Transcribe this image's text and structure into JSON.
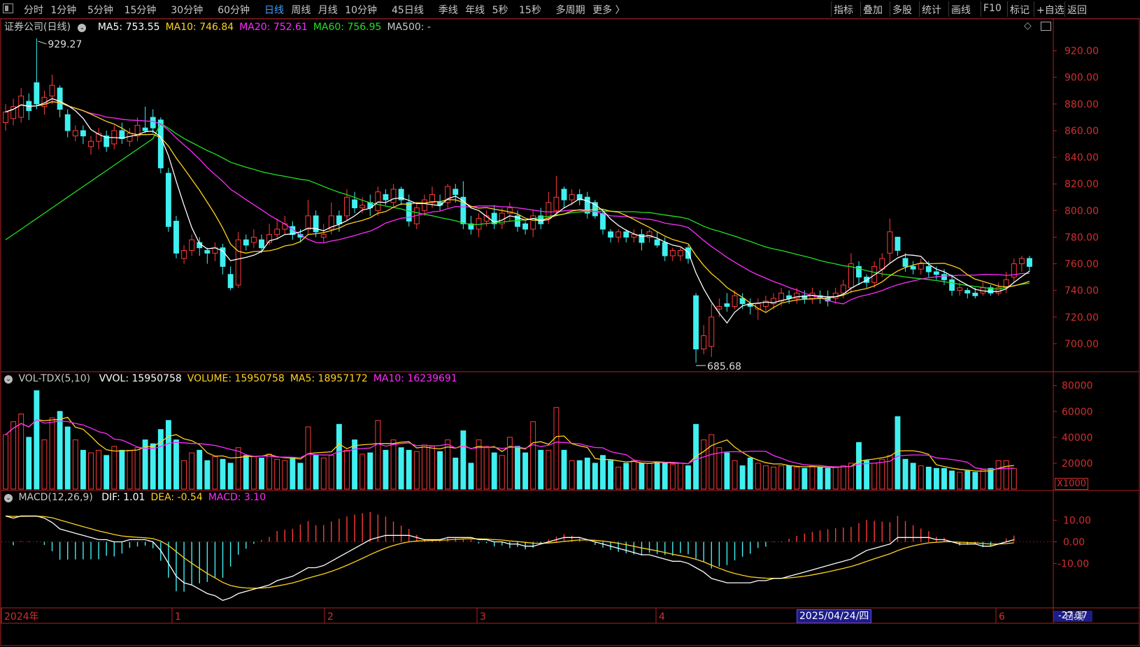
{
  "toolbar": {
    "periods": [
      "分时",
      "1分钟",
      "5分钟",
      "15分钟",
      "30分钟",
      "60分钟",
      "日线",
      "周线",
      "月线",
      "10分钟",
      "45日线",
      "季线",
      "年线",
      "5秒",
      "15秒",
      "多周期",
      "更多 〉"
    ],
    "active_period": "日线",
    "right_buttons": [
      "指标",
      "叠加",
      "多股",
      "统计",
      "画线",
      "F10",
      "标记",
      "+自选",
      "返回"
    ]
  },
  "price_panel": {
    "title": "证券公司(日线)",
    "ma_labels": [
      {
        "text": "MA5: 753.55",
        "color": "#ffffff"
      },
      {
        "text": "MA10: 746.84",
        "color": "#ffd21e"
      },
      {
        "text": "MA20: 752.61",
        "color": "#ff2cff"
      },
      {
        "text": "MA60: 756.95",
        "color": "#22e022"
      },
      {
        "text": "MA500: -",
        "color": "#c8c8c8"
      }
    ],
    "y_ticks": [
      "920.00",
      "900.00",
      "880.00",
      "860.00",
      "840.00",
      "820.00",
      "800.00",
      "780.00",
      "760.00",
      "740.00",
      "720.00",
      "700.00"
    ],
    "high_label": "929.27",
    "low_label": "685.68"
  },
  "volume_panel": {
    "title": "VOL-TDX(5,10)",
    "labels": [
      {
        "text": "VVOL: 15950758",
        "color": "#ffffff"
      },
      {
        "text": "VOLUME: 15950758",
        "color": "#ffd21e"
      },
      {
        "text": "MA5: 18957172",
        "color": "#ffd21e"
      },
      {
        "text": "MA10: 16239691",
        "color": "#ff2cff"
      }
    ],
    "y_ticks": [
      "80000",
      "60000",
      "40000",
      "20000"
    ],
    "unit": "X1000"
  },
  "macd_panel": {
    "title": "MACD(12,26,9)",
    "labels": [
      {
        "text": "DIF: 1.01",
        "color": "#ffffff"
      },
      {
        "text": "DEA: -0.54",
        "color": "#ffd21e"
      },
      {
        "text": "MACD: 3.10",
        "color": "#ff2cff"
      }
    ],
    "y_ticks": [
      "10.00",
      "0.00",
      "-10.00"
    ],
    "min_label": "-27.17"
  },
  "x_axis": {
    "labels": [
      "2024年",
      "1",
      "2",
      "3",
      "4",
      "6"
    ],
    "cursor_date": "2025/04/24/四",
    "period_label": "日线"
  },
  "colors": {
    "up": "#ff3b3b",
    "down": "#40f0f0",
    "ma5": "#ffffff",
    "ma10": "#ffd21e",
    "ma20": "#ff2cff",
    "ma60": "#22e022",
    "axis": "#b02020"
  },
  "chart_data": {
    "type": "candlestick",
    "title": "证券公司(日线)",
    "ylim": [
      680,
      935
    ],
    "candles": [
      [
        866,
        874,
        880,
        860
      ],
      [
        869,
        878,
        884,
        864
      ],
      [
        870,
        886,
        892,
        866
      ],
      [
        882,
        875,
        888,
        868
      ],
      [
        896,
        880,
        929.27,
        876
      ],
      [
        878,
        885,
        890,
        872
      ],
      [
        886,
        894,
        902,
        880
      ],
      [
        892,
        876,
        894,
        870
      ],
      [
        872,
        860,
        876,
        855
      ],
      [
        856,
        860,
        864,
        852
      ],
      [
        860,
        856,
        864,
        850
      ],
      [
        848,
        852,
        856,
        842
      ],
      [
        852,
        858,
        862,
        846
      ],
      [
        856,
        848,
        860,
        844
      ],
      [
        850,
        860,
        864,
        846
      ],
      [
        860,
        854,
        866,
        850
      ],
      [
        852,
        858,
        862,
        848
      ],
      [
        856,
        864,
        870,
        852
      ],
      [
        862,
        860,
        878,
        858
      ],
      [
        870,
        862,
        876,
        858
      ],
      [
        868,
        832,
        870,
        828
      ],
      [
        828,
        788,
        832,
        784
      ],
      [
        792,
        768,
        796,
        764
      ],
      [
        764,
        770,
        774,
        760
      ],
      [
        770,
        778,
        782,
        766
      ],
      [
        776,
        772,
        780,
        766
      ],
      [
        770,
        768,
        772,
        760
      ],
      [
        768,
        772,
        776,
        762
      ],
      [
        772,
        758,
        775,
        752
      ],
      [
        752,
        742,
        758,
        740
      ],
      [
        744,
        778,
        784,
        742
      ],
      [
        778,
        774,
        782,
        770
      ],
      [
        776,
        780,
        786,
        772
      ],
      [
        778,
        772,
        782,
        768
      ],
      [
        776,
        782,
        790,
        774
      ],
      [
        782,
        786,
        794,
        778
      ],
      [
        786,
        790,
        796,
        782
      ],
      [
        788,
        782,
        792,
        778
      ],
      [
        782,
        780,
        786,
        776
      ],
      [
        786,
        796,
        808,
        782
      ],
      [
        796,
        784,
        800,
        780
      ],
      [
        780,
        782,
        790,
        776
      ],
      [
        786,
        796,
        806,
        782
      ],
      [
        796,
        790,
        800,
        784
      ],
      [
        796,
        810,
        816,
        792
      ],
      [
        808,
        802,
        814,
        798
      ],
      [
        802,
        804,
        810,
        798
      ],
      [
        806,
        802,
        812,
        796
      ],
      [
        800,
        814,
        818,
        796
      ],
      [
        812,
        808,
        816,
        804
      ],
      [
        806,
        816,
        820,
        802
      ],
      [
        816,
        808,
        818,
        804
      ],
      [
        806,
        792,
        812,
        788
      ],
      [
        790,
        802,
        806,
        786
      ],
      [
        800,
        808,
        812,
        796
      ],
      [
        806,
        812,
        818,
        802
      ],
      [
        806,
        804,
        812,
        800
      ],
      [
        806,
        818,
        820,
        802
      ],
      [
        816,
        812,
        820,
        806
      ],
      [
        810,
        790,
        822,
        786
      ],
      [
        790,
        786,
        796,
        782
      ],
      [
        786,
        794,
        798,
        780
      ],
      [
        792,
        796,
        800,
        788
      ],
      [
        798,
        790,
        804,
        786
      ],
      [
        790,
        798,
        802,
        786
      ],
      [
        798,
        802,
        806,
        792
      ],
      [
        796,
        788,
        800,
        784
      ],
      [
        790,
        786,
        792,
        782
      ],
      [
        786,
        796,
        800,
        780
      ],
      [
        796,
        790,
        802,
        786
      ],
      [
        794,
        806,
        814,
        790
      ],
      [
        800,
        810,
        826,
        796
      ],
      [
        816,
        808,
        818,
        802
      ],
      [
        808,
        812,
        816,
        804
      ],
      [
        812,
        808,
        816,
        804
      ],
      [
        810,
        798,
        814,
        794
      ],
      [
        806,
        796,
        808,
        794
      ],
      [
        798,
        786,
        800,
        782
      ],
      [
        784,
        780,
        786,
        776
      ],
      [
        780,
        784,
        786,
        776
      ],
      [
        784,
        780,
        786,
        776
      ],
      [
        780,
        782,
        786,
        776
      ],
      [
        782,
        776,
        786,
        770
      ],
      [
        780,
        784,
        786,
        776
      ],
      [
        778,
        774,
        784,
        772
      ],
      [
        776,
        766,
        780,
        762
      ],
      [
        766,
        770,
        772,
        762
      ],
      [
        766,
        770,
        772,
        762
      ],
      [
        772,
        764,
        774,
        760
      ],
      [
        736,
        696,
        738,
        685.68
      ],
      [
        696,
        706,
        714,
        692
      ],
      [
        698,
        720,
        730,
        690
      ],
      [
        726,
        728,
        734,
        720
      ],
      [
        730,
        728,
        738,
        724
      ],
      [
        728,
        736,
        740,
        726
      ],
      [
        734,
        730,
        738,
        726
      ],
      [
        730,
        728,
        734,
        722
      ],
      [
        726,
        730,
        734,
        718
      ],
      [
        728,
        732,
        736,
        724
      ],
      [
        730,
        734,
        738,
        726
      ],
      [
        732,
        738,
        742,
        728
      ],
      [
        736,
        734,
        740,
        730
      ],
      [
        734,
        738,
        742,
        730
      ],
      [
        736,
        734,
        740,
        730
      ],
      [
        734,
        738,
        742,
        730
      ],
      [
        736,
        734,
        740,
        730
      ],
      [
        734,
        732,
        740,
        728
      ],
      [
        734,
        738,
        742,
        730
      ],
      [
        738,
        744,
        748,
        734
      ],
      [
        742,
        760,
        768,
        738
      ],
      [
        758,
        750,
        762,
        744
      ],
      [
        750,
        746,
        752,
        742
      ],
      [
        746,
        758,
        762,
        742
      ],
      [
        756,
        764,
        768,
        750
      ],
      [
        768,
        784,
        794,
        760
      ],
      [
        780,
        770,
        778,
        766
      ],
      [
        764,
        758,
        768,
        754
      ],
      [
        758,
        756,
        762,
        752
      ],
      [
        756,
        760,
        764,
        752
      ],
      [
        758,
        754,
        762,
        750
      ],
      [
        754,
        752,
        758,
        748
      ],
      [
        752,
        748,
        756,
        744
      ],
      [
        748,
        740,
        752,
        736
      ],
      [
        740,
        742,
        746,
        736
      ],
      [
        740,
        738,
        742,
        734
      ],
      [
        738,
        736,
        742,
        734
      ],
      [
        738,
        742,
        746,
        736
      ],
      [
        742,
        738,
        744,
        736
      ],
      [
        738,
        742,
        746,
        736
      ],
      [
        742,
        748,
        754,
        738
      ],
      [
        750,
        760,
        764,
        746
      ],
      [
        760,
        764,
        766,
        754
      ],
      [
        764,
        758,
        766,
        754
      ]
    ],
    "volume": [
      42,
      52,
      58,
      40,
      76,
      38,
      55,
      60,
      48,
      38,
      30,
      28,
      30,
      26,
      33,
      30,
      30,
      32,
      38,
      35,
      46,
      53,
      38,
      22,
      28,
      30,
      22,
      25,
      23,
      20,
      32,
      26,
      25,
      24,
      27,
      23,
      22,
      24,
      20,
      48,
      26,
      24,
      26,
      50,
      30,
      38,
      27,
      28,
      53,
      30,
      38,
      32,
      30,
      29,
      34,
      33,
      29,
      38,
      24,
      45,
      20,
      38,
      33,
      28,
      26,
      40,
      33,
      28,
      52,
      30,
      30,
      63,
      30,
      22,
      22,
      24,
      20,
      26,
      22,
      17,
      20,
      22,
      20,
      20,
      21,
      20,
      19,
      20,
      18,
      50,
      38,
      42,
      32,
      28,
      22,
      18,
      24,
      20,
      18,
      17,
      18,
      18,
      17,
      16,
      18,
      17,
      16,
      17,
      18,
      20,
      36,
      22,
      20,
      23,
      26,
      56,
      23,
      20,
      18,
      17,
      16,
      16,
      14,
      13,
      14,
      13,
      15,
      16,
      22,
      22,
      16
    ],
    "dif": [
      12,
      11,
      12,
      12,
      12,
      11,
      9,
      6,
      5,
      4,
      3,
      2,
      1,
      1,
      0,
      0,
      1,
      1,
      1,
      0,
      -4,
      -10,
      -16,
      -19,
      -20,
      -22,
      -24,
      -25,
      -27.17,
      -26,
      -24,
      -23,
      -22,
      -21,
      -20,
      -18,
      -17,
      -16,
      -14,
      -12,
      -12,
      -11,
      -9,
      -7,
      -5,
      -3,
      -1,
      1,
      2,
      3,
      3,
      3,
      3,
      2,
      1,
      1,
      1,
      2,
      2,
      2,
      2,
      1,
      1,
      0,
      0,
      -1,
      -1,
      -2,
      -2,
      -1,
      0,
      1,
      2,
      2,
      2,
      1,
      0,
      -1,
      -2,
      -3,
      -4,
      -5,
      -6,
      -6,
      -7,
      -8,
      -9,
      -9,
      -10,
      -12,
      -14,
      -17,
      -18,
      -19,
      -19,
      -19,
      -19,
      -18,
      -18,
      -17,
      -17,
      -16,
      -15,
      -14,
      -13,
      -12,
      -11,
      -10,
      -9,
      -8,
      -6,
      -4,
      -3,
      -2,
      -1,
      2,
      2,
      2,
      2,
      2,
      1,
      1,
      0,
      -1,
      -1,
      -1,
      -2,
      -2,
      -1,
      0,
      1
    ]
  }
}
